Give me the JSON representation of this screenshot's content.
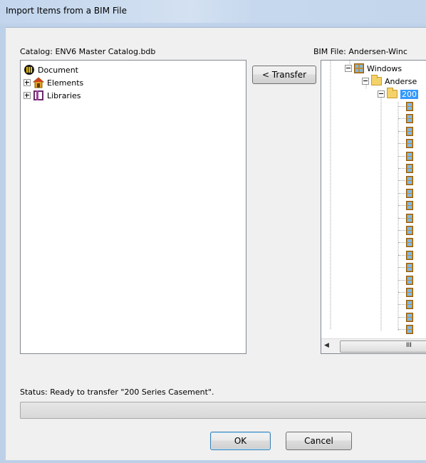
{
  "window": {
    "title": "Import Items from a BIM File"
  },
  "catalog": {
    "label": "Catalog: ENV6 Master Catalog.bdb",
    "tree": [
      {
        "label": "Document",
        "icon": "document-icon"
      },
      {
        "label": "Elements",
        "icon": "elements-icon"
      },
      {
        "label": "Libraries",
        "icon": "libraries-icon"
      }
    ]
  },
  "transfer_button": "< Transfer",
  "bim": {
    "label": "BIM File: Andersen-Winc",
    "tree": [
      {
        "label": "Windows",
        "icon": "window-icon"
      },
      {
        "label": "Anderse",
        "icon": "folder-open-icon"
      },
      {
        "label": "200",
        "icon": "folder-open-icon",
        "selected": true
      }
    ],
    "scroll_thumb_label": "III"
  },
  "status": {
    "text": "Status:  Ready to transfer \"200 Series Casement\".",
    "progress": 0
  },
  "buttons": {
    "ok": "OK",
    "cancel": "Cancel"
  }
}
